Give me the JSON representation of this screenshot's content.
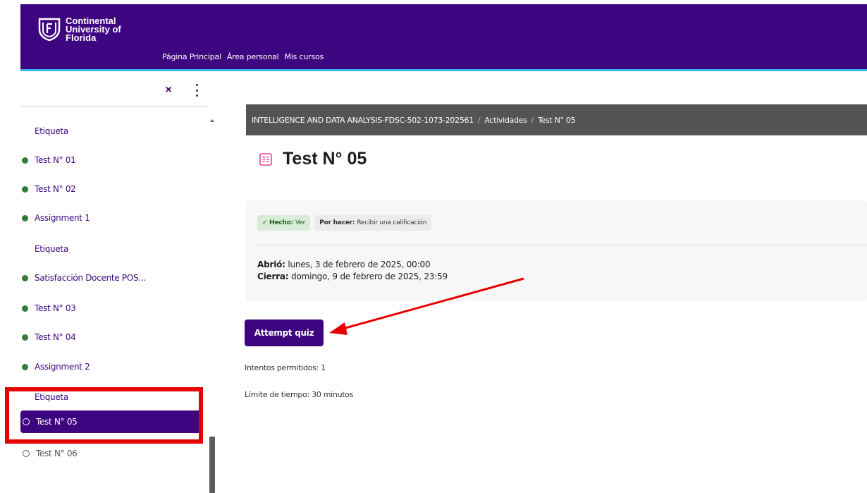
{
  "header": {
    "logo_lines": [
      "Continental",
      "University of",
      "Florida"
    ],
    "nav": [
      "Página Principal",
      "Área personal",
      "Mis cursos"
    ]
  },
  "sidebar": {
    "close_label": "×",
    "items": [
      {
        "label": "Etiqueta",
        "kind": "label"
      },
      {
        "label": "Test N° 01",
        "kind": "done"
      },
      {
        "label": "Test N° 02",
        "kind": "done"
      },
      {
        "label": "Assignment 1",
        "kind": "done"
      },
      {
        "label": "Etiqueta",
        "kind": "label"
      },
      {
        "label": "Satisfacción Docente POS...",
        "kind": "done"
      },
      {
        "label": "Test N° 03",
        "kind": "done"
      },
      {
        "label": "Test N° 04",
        "kind": "done"
      },
      {
        "label": "Assignment 2",
        "kind": "done"
      },
      {
        "label": "Etiqueta",
        "kind": "label"
      },
      {
        "label": "Test N° 05",
        "kind": "active"
      },
      {
        "label": "Test N° 06",
        "kind": "open"
      }
    ]
  },
  "breadcrumb": {
    "course": "INTELLIGENCE AND DATA ANALYSIS-FDSC-502-1073-202561",
    "section": "Actividades",
    "current": "Test N° 05"
  },
  "page": {
    "title": "Test N° 05",
    "badge_done_label": "Hecho:",
    "badge_done_value": "Ver",
    "badge_todo_label": "Por hacer:",
    "badge_todo_value": "Recibir una calificación",
    "opened_label": "Abrió:",
    "opened_value": "lunes, 3 de febrero de 2025, 00:00",
    "closes_label": "Cierra:",
    "closes_value": "domingo, 9 de febrero de 2025, 23:59",
    "attempt_button": "Attempt quiz",
    "attempts_allowed": "Intentos permitidos: 1",
    "time_limit": "Límite de tiempo: 30 minutos"
  },
  "colors": {
    "brand": "#3d0680",
    "accent_line": "#35b5e6",
    "complete_dot": "#357a38",
    "annotation": "#e60000"
  }
}
